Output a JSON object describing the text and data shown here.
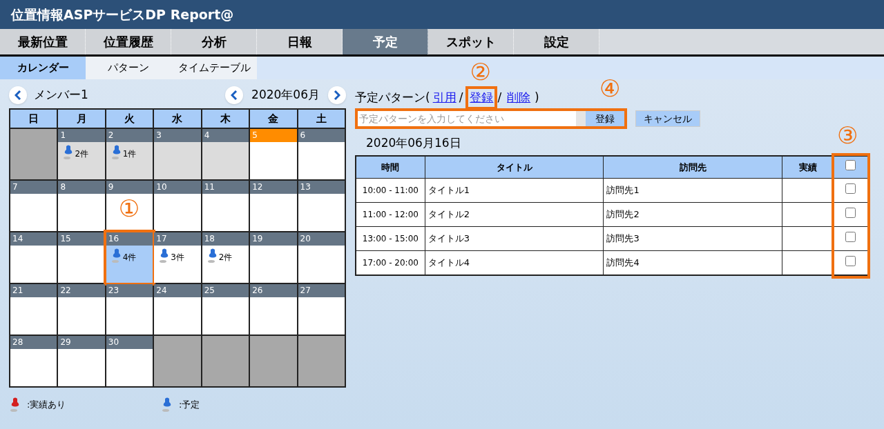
{
  "header": {
    "title": "位置情報ASPサービスDP Report@"
  },
  "tabs": [
    {
      "label": "最新位置",
      "selected": false
    },
    {
      "label": "位置履歴",
      "selected": false
    },
    {
      "label": "分析",
      "selected": false
    },
    {
      "label": "日報",
      "selected": false
    },
    {
      "label": "予定",
      "selected": true
    },
    {
      "label": "スポット",
      "selected": false
    },
    {
      "label": "設定",
      "selected": false
    }
  ],
  "subtabs": [
    {
      "label": "カレンダー",
      "selected": true
    },
    {
      "label": "パターン",
      "selected": false
    },
    {
      "label": "タイムテーブル",
      "selected": false
    }
  ],
  "calendar": {
    "member": "メンバー1",
    "month": "2020年06月",
    "weekdays": [
      "日",
      "月",
      "火",
      "水",
      "木",
      "金",
      "土"
    ],
    "weeks": [
      [
        {
          "kind": "outside"
        },
        {
          "kind": "past",
          "day": "1",
          "count": "2件"
        },
        {
          "kind": "past",
          "day": "2",
          "count": "1件"
        },
        {
          "kind": "past",
          "day": "3"
        },
        {
          "kind": "past",
          "day": "4"
        },
        {
          "kind": "today",
          "day": "5"
        },
        {
          "kind": "normal",
          "day": "6"
        }
      ],
      [
        {
          "kind": "normal",
          "day": "7"
        },
        {
          "kind": "normal",
          "day": "8"
        },
        {
          "kind": "normal",
          "day": "9"
        },
        {
          "kind": "normal",
          "day": "10"
        },
        {
          "kind": "normal",
          "day": "11"
        },
        {
          "kind": "normal",
          "day": "12"
        },
        {
          "kind": "normal",
          "day": "13"
        }
      ],
      [
        {
          "kind": "normal",
          "day": "14"
        },
        {
          "kind": "normal",
          "day": "15"
        },
        {
          "kind": "selected",
          "day": "16",
          "count": "4件",
          "annotation": "①"
        },
        {
          "kind": "normal",
          "day": "17",
          "count": "3件"
        },
        {
          "kind": "normal",
          "day": "18",
          "count": "2件"
        },
        {
          "kind": "normal",
          "day": "19"
        },
        {
          "kind": "normal",
          "day": "20"
        }
      ],
      [
        {
          "kind": "normal",
          "day": "21"
        },
        {
          "kind": "normal",
          "day": "22"
        },
        {
          "kind": "normal",
          "day": "23"
        },
        {
          "kind": "normal",
          "day": "24"
        },
        {
          "kind": "normal",
          "day": "25"
        },
        {
          "kind": "normal",
          "day": "26"
        },
        {
          "kind": "normal",
          "day": "27"
        }
      ],
      [
        {
          "kind": "normal",
          "day": "28"
        },
        {
          "kind": "normal",
          "day": "29"
        },
        {
          "kind": "normal",
          "day": "30"
        },
        {
          "kind": "outside"
        },
        {
          "kind": "outside"
        },
        {
          "kind": "outside"
        },
        {
          "kind": "outside"
        }
      ]
    ],
    "legend": [
      {
        "color": "#d42020",
        "label": ":実績あり"
      },
      {
        "color": "#2a6fd6",
        "label": ":予定"
      }
    ]
  },
  "pattern": {
    "label": "予定パターン(",
    "links": [
      {
        "label": "引用"
      },
      {
        "label": "登録",
        "annotation": "②"
      },
      {
        "label": "削除"
      }
    ],
    "separator": "/",
    "close": ")",
    "input_placeholder": "予定パターンを入力してください",
    "register_button": "登録",
    "input_annotation": "④",
    "cancel_button": "キャンセル"
  },
  "schedule": {
    "date": "2020年06月16日",
    "columns": [
      "時間",
      "タイトル",
      "訪問先",
      "実績"
    ],
    "check_annotation": "③",
    "header_checked": false,
    "rows": [
      {
        "time": "10:00 - 11:00",
        "title": "タイトル1",
        "place": "訪問先1",
        "result": "",
        "checked": false
      },
      {
        "time": "11:00 - 12:00",
        "title": "タイトル2",
        "place": "訪問先2",
        "result": "",
        "checked": false
      },
      {
        "time": "13:00 - 15:00",
        "title": "タイトル3",
        "place": "訪問先3",
        "result": "",
        "checked": false
      },
      {
        "time": "17:00 - 20:00",
        "title": "タイトル4",
        "place": "訪問先4",
        "result": "",
        "checked": false
      }
    ]
  }
}
